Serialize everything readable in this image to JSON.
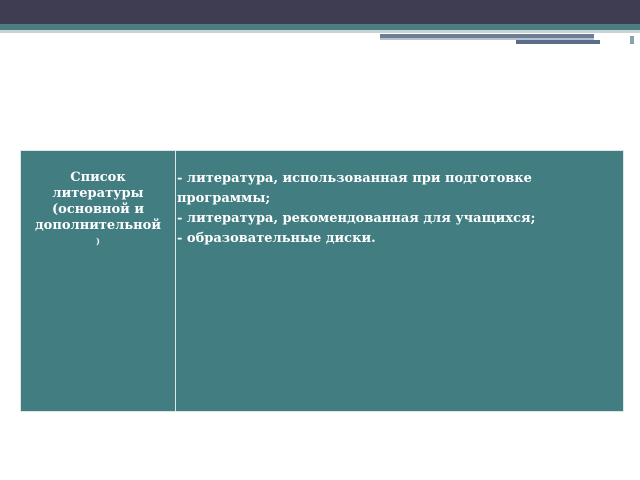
{
  "table": {
    "label_lines": [
      "Список",
      "литературы",
      "(основной и",
      "дополнительной"
    ],
    "label_tail": ")",
    "items": [
      "- литература, использованная при подготовке",
      "программы;",
      "- литература, рекомендованная для учащихся;",
      "- образовательные диски."
    ]
  },
  "colors": {
    "header_dark": "#3f3d51",
    "teal_accent": "#4a7e83",
    "table_fill": "#427d82"
  }
}
